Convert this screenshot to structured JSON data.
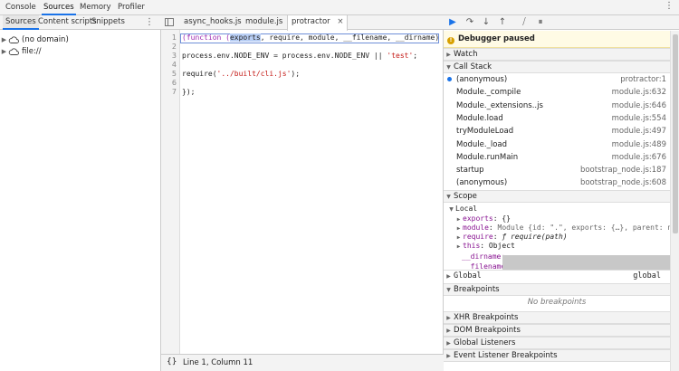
{
  "top_tabs": [
    "Console",
    "Sources",
    "Memory",
    "Profiler"
  ],
  "navigator": {
    "tabs": [
      "Sources",
      "Content scripts",
      "Snippets"
    ],
    "more": "⋮",
    "items": [
      "(no domain)",
      "file://"
    ]
  },
  "editor": {
    "tabs": [
      "async_hooks.js",
      "module.js",
      "protractor"
    ],
    "close": "×",
    "line_numbers": [
      "1",
      "2",
      "3",
      "4",
      "5",
      "6",
      "7"
    ],
    "lines": {
      "l1_a": "(function (",
      "l1_sel": "exports",
      "l1_b": ", require, module, __filename, __dirname) {",
      "l3_a": "process.env.NODE_ENV = process.env.NODE_ENV || ",
      "l3_str": "'test'",
      "l3_b": ";",
      "l5_a": "require(",
      "l5_str": "'../built/cli.js'",
      "l5_b": ");",
      "l7": "});"
    },
    "status_braces": "{}",
    "status_position": "Line 1, Column 11"
  },
  "debugger": {
    "toolbar_icons": [
      "resume-icon",
      "step-over-icon",
      "step-into-icon",
      "step-out-icon",
      "deactivate-breakpoints-icon",
      "pause-exceptions-icon"
    ],
    "paused_text": "Debugger paused",
    "watch_label": "Watch",
    "call_stack_label": "Call Stack",
    "frames": [
      {
        "fn": "(anonymous)",
        "loc": "protractor:1"
      },
      {
        "fn": "Module._compile",
        "loc": "module.js:632"
      },
      {
        "fn": "Module._extensions..js",
        "loc": "module.js:646"
      },
      {
        "fn": "Module.load",
        "loc": "module.js:554"
      },
      {
        "fn": "tryModuleLoad",
        "loc": "module.js:497"
      },
      {
        "fn": "Module._load",
        "loc": "module.js:489"
      },
      {
        "fn": "Module.runMain",
        "loc": "module.js:676"
      },
      {
        "fn": "startup",
        "loc": "bootstrap_node.js:187"
      },
      {
        "fn": "(anonymous)",
        "loc": "bootstrap_node.js:608"
      }
    ],
    "scope_label": "Scope",
    "local_label": "Local",
    "scope": {
      "exports_key": "exports",
      "exports_val": "{}",
      "module_key": "module",
      "module_val": "Module {id: \".\", exports: {…}, parent: null, f",
      "require_key": "require",
      "require_val": "ƒ require(path)",
      "this_key": "this",
      "this_val": "Object",
      "dirname_key": "__dirname:",
      "filename_key": "__filename:"
    },
    "global_label": "Global",
    "global_value": "global",
    "breakpoints_label": "Breakpoints",
    "no_breakpoints": "No breakpoints",
    "xhr_label": "XHR Breakpoints",
    "dom_label": "DOM Breakpoints",
    "listeners_label": "Global Listeners",
    "event_label": "Event Listener Breakpoints"
  },
  "colors": {
    "accent": "#1a73e8",
    "paused_bg": "#fffbe5"
  }
}
